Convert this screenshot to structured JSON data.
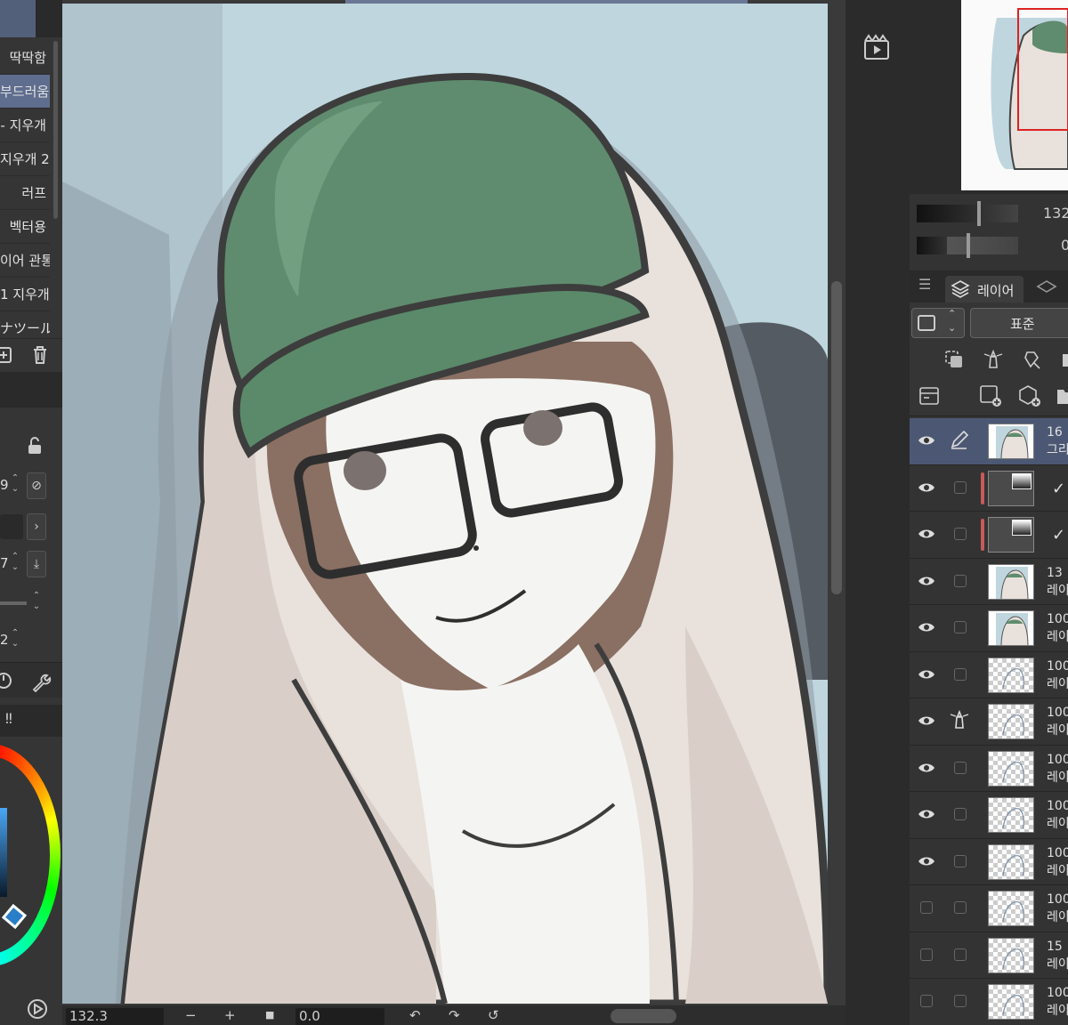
{
  "brush_panel": {
    "items": [
      {
        "label": "딱딱함",
        "selected": false
      },
      {
        "label": "부드러움",
        "selected": true
      },
      {
        "label": "- 지우개",
        "selected": false
      },
      {
        "label": "지우개 2",
        "selected": false
      },
      {
        "label": "러프",
        "selected": false
      },
      {
        "label": "벡터용",
        "selected": false
      },
      {
        "label": "이어 관통",
        "selected": false
      },
      {
        "label": "1 지우개",
        "selected": false
      },
      {
        "label": "ナツール",
        "selected": false
      }
    ]
  },
  "tool_property": {
    "values": [
      "9",
      "7",
      "2"
    ]
  },
  "status_bar": {
    "zoom": "132.3",
    "zoom_out": "−",
    "zoom_in": "+",
    "angle": "0.0"
  },
  "navigator": {
    "zoom_value": "132",
    "rotate_value": "0"
  },
  "layer_panel": {
    "tab_label": "레이어",
    "blend_mode": "표준",
    "layers": [
      {
        "visible": true,
        "opacity": "16",
        "name": "그리",
        "thumb": "art",
        "selected": true,
        "icon": "pen",
        "mask": false,
        "clip": false
      },
      {
        "visible": true,
        "opacity": "",
        "name": "",
        "thumb": "dark",
        "selected": false,
        "icon": "box",
        "mask": true,
        "clip": true
      },
      {
        "visible": true,
        "opacity": "",
        "name": "",
        "thumb": "dark",
        "selected": false,
        "icon": "box",
        "mask": true,
        "clip": true
      },
      {
        "visible": true,
        "opacity": "13",
        "name": "레이",
        "thumb": "art",
        "selected": false,
        "icon": "box",
        "mask": false,
        "clip": false
      },
      {
        "visible": true,
        "opacity": "100",
        "name": "레이",
        "thumb": "art",
        "selected": false,
        "icon": "box",
        "mask": false,
        "clip": false
      },
      {
        "visible": true,
        "opacity": "100",
        "name": "레이",
        "thumb": "checker",
        "selected": false,
        "icon": "box",
        "mask": false,
        "clip": false
      },
      {
        "visible": true,
        "opacity": "100",
        "name": "레이",
        "thumb": "checker",
        "selected": false,
        "icon": "lighthouse",
        "mask": false,
        "clip": false
      },
      {
        "visible": true,
        "opacity": "100",
        "name": "레이",
        "thumb": "checker",
        "selected": false,
        "icon": "box",
        "mask": false,
        "clip": false
      },
      {
        "visible": true,
        "opacity": "100",
        "name": "레이",
        "thumb": "checker",
        "selected": false,
        "icon": "box",
        "mask": false,
        "clip": false
      },
      {
        "visible": true,
        "opacity": "100",
        "name": "레이",
        "thumb": "checker",
        "selected": false,
        "icon": "box",
        "mask": false,
        "clip": false
      },
      {
        "visible": false,
        "opacity": "100",
        "name": "레이",
        "thumb": "checker",
        "selected": false,
        "icon": "box",
        "mask": false,
        "clip": false
      },
      {
        "visible": false,
        "opacity": "15",
        "name": "레이",
        "thumb": "checker",
        "selected": false,
        "icon": "box",
        "mask": false,
        "clip": false
      },
      {
        "visible": false,
        "opacity": "100",
        "name": "레이",
        "thumb": "checker",
        "selected": false,
        "icon": "box",
        "mask": false,
        "clip": false
      }
    ]
  },
  "icons": {
    "brush_tools": [
      "add-brush-icon",
      "trash-icon"
    ],
    "tool_props": [
      "lock-icon",
      "settings-icon",
      "wrench-icon"
    ],
    "status_bar": [
      "rotate-left-icon",
      "rotate-right-icon",
      "reset-rotation-icon"
    ],
    "mid_strip": [
      "timeline-icon"
    ],
    "layer_panel": [
      "menu-icon",
      "layers-icon",
      "copy-layer-icon",
      "reference-layer-icon",
      "draft-layer-icon",
      "new-raster-layer-icon",
      "new-vector-layer-icon",
      "new-folder-icon"
    ]
  },
  "colors": {
    "accent": "#5f6d8e",
    "selected_layer": "#4c5873",
    "clip_bar": "#c85a5a",
    "current_color": "#2a7ec7"
  }
}
